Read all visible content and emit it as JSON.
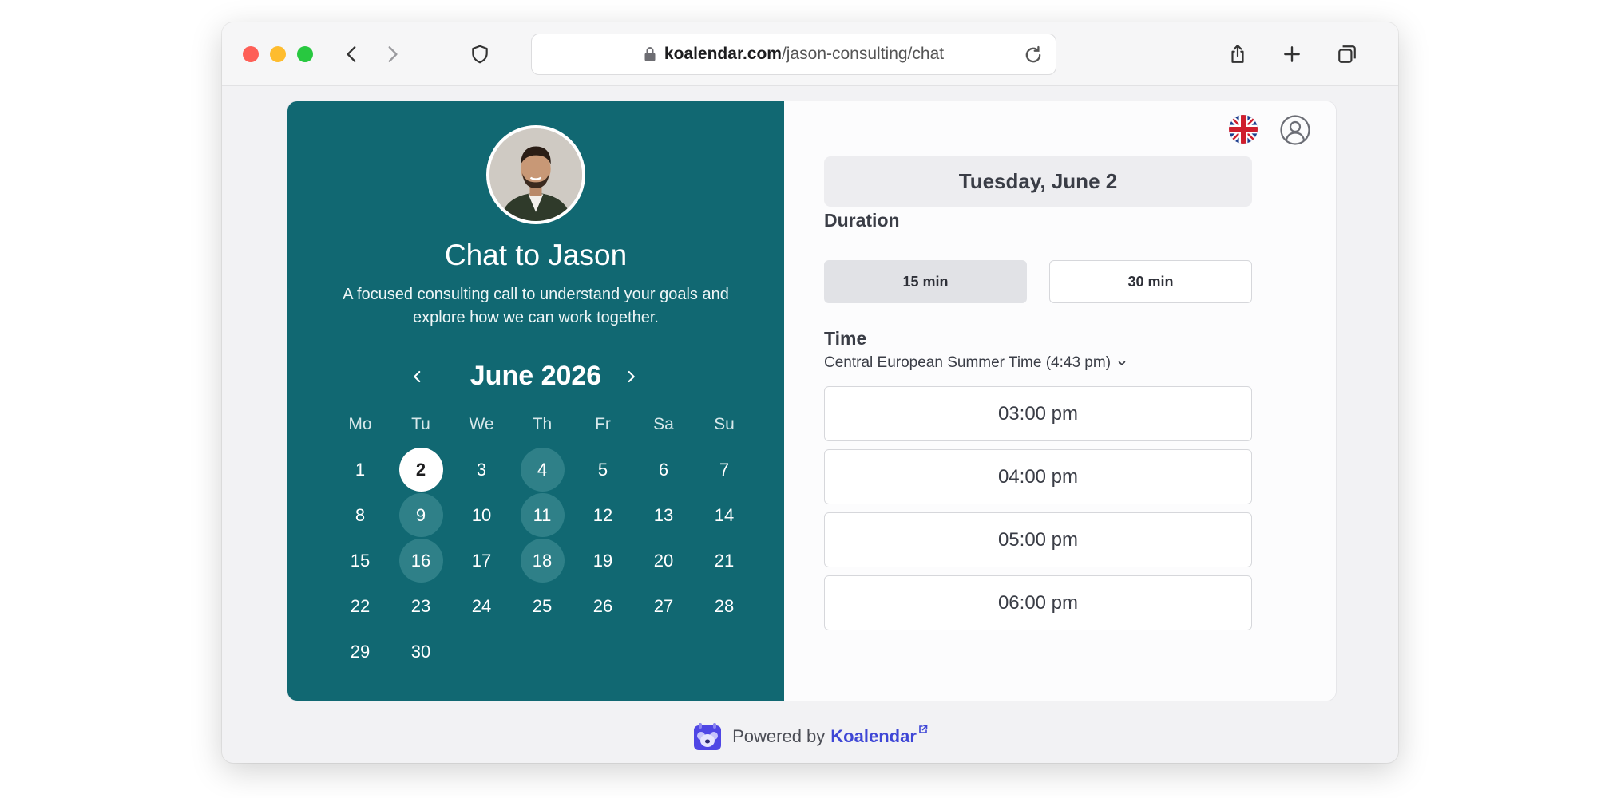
{
  "browser": {
    "url_domain": "koalendar.com",
    "url_path": "/jason-consulting/chat"
  },
  "event": {
    "title": "Chat to Jason",
    "description": "A focused consulting call to understand your goals and explore how we can work together."
  },
  "calendar": {
    "month_label": "June 2026",
    "weekdays": [
      "Mo",
      "Tu",
      "We",
      "Th",
      "Fr",
      "Sa",
      "Su"
    ],
    "first_weekday_index": 0,
    "days_in_month": 30,
    "selected_day": 2,
    "available_days": [
      4,
      9,
      11,
      16,
      18
    ]
  },
  "booking": {
    "selected_date": "Tuesday, June 2",
    "duration_label": "Duration",
    "durations": [
      "15 min",
      "30 min"
    ],
    "active_duration_index": 0,
    "time_label": "Time",
    "timezone": "Central European Summer Time (4:43 pm)",
    "slots": [
      "03:00 pm",
      "04:00 pm",
      "05:00 pm",
      "06:00 pm"
    ]
  },
  "footer": {
    "powered_by": "Powered by",
    "brand": "Koalendar"
  },
  "colors": {
    "panel_teal": "#116872",
    "available_day": "#2f8088",
    "brand_link": "#3f47d6"
  },
  "icons": [
    "back-icon",
    "forward-icon",
    "shield-icon",
    "lock-icon",
    "reload-icon",
    "share-icon",
    "new-tab-icon",
    "tabs-icon",
    "uk-flag-icon",
    "user-profile-icon",
    "koalendar-logo-icon",
    "external-link-icon",
    "chevron-down-icon",
    "chevron-left-icon",
    "chevron-right-icon"
  ]
}
